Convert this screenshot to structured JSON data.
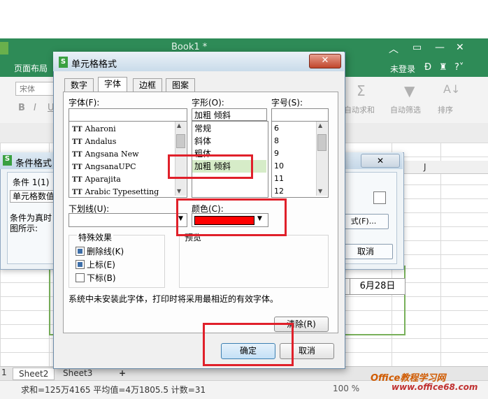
{
  "app": {
    "title": "Book1 *",
    "menu_page_layout": "页面布局",
    "login": "未登录",
    "font_name": "宋体",
    "ribbon": {
      "bold": "B",
      "italic": "I",
      "underline": "U",
      "autosum": "自动求和",
      "autofilter": "自动筛选",
      "sort": "排序"
    },
    "column_j": "J",
    "cell_date": "6月28日",
    "sheets": [
      "Sheet2",
      "Sheet3"
    ],
    "add_sheet": "+",
    "status": "求和=125万4165  平均值=4万1805.5  计数=31",
    "zoom": "100 %",
    "watermark": "Office教程学习网",
    "watermark_url": "www.office68.com"
  },
  "cond_dialog": {
    "title": "条件格式",
    "close": "✕",
    "condition_label": "条件 1(1)",
    "condition_value": "单元格数值",
    "desc_line1": "条件为真时",
    "desc_line2": "图所示:",
    "format_button": "式(F)...",
    "cancel_button": "取消"
  },
  "dialog": {
    "title": "单元格格式",
    "close": "✕",
    "tabs": [
      "数字",
      "字体",
      "边框",
      "图案"
    ],
    "font_label": "字体(F):",
    "style_label": "字形(O):",
    "size_label": "字号(S):",
    "style_value": "加粗 倾斜",
    "fonts": [
      "Aharoni",
      "Andalus",
      "Angsana New",
      "AngsanaUPC",
      "Aparajita",
      "Arabic Typesetting"
    ],
    "styles": [
      "常规",
      "斜体",
      "粗体",
      "加粗 倾斜"
    ],
    "sizes": [
      "6",
      "8",
      "9",
      "10",
      "11",
      "12"
    ],
    "underline_label": "下划线(U):",
    "color_label": "颜色(C):",
    "color_value": "#ff0000",
    "effects_label": "特殊效果",
    "effects": [
      {
        "label": "删除线(K)",
        "checked": true
      },
      {
        "label": "上标(E)",
        "checked": true
      },
      {
        "label": "下标(B)",
        "checked": false
      }
    ],
    "preview_label": "预览",
    "notice": "系统中未安装此字体，打印时将采用最相近的有效字体。",
    "clear_button": "清除(R)",
    "ok_button": "确定",
    "cancel_button": "取消"
  }
}
